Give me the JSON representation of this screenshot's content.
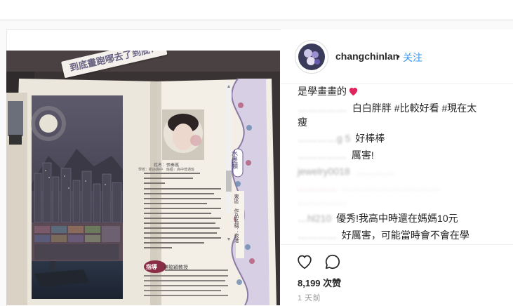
{
  "colors": {
    "accent": "#3897f0",
    "heart": "#ed4956",
    "text": "#262626",
    "muted": "#999999"
  },
  "header": {
    "username": "changchinlan",
    "separator": "•",
    "follow_label": "关注"
  },
  "photo": {
    "banner": "到底畫跑哪去了到底？",
    "side_label_1": "水墨類",
    "side_label_2": "東區　作品名稱：夜港",
    "caption_block_1": "姓名：張秦嵐",
    "caption_block_2": "學校：新店高中　班級：高中普通班",
    "teacher_label": "指導",
    "teacher_name": "林懿穎教授"
  },
  "comments": [
    {
      "user": "",
      "text": "是學畫畫的",
      "emoji": "heart-emoji"
    },
    {
      "user": "……………",
      "text": "白白胖胖 #比較好看 #現在太"
    },
    {
      "user": "",
      "text": "瘦"
    },
    {
      "user": "…………g 5",
      "text": "好棒棒"
    },
    {
      "user": "……………",
      "text": "厲害!"
    },
    {
      "user": "jewelry0018",
      "text": "…………"
    },
    {
      "user": "…………",
      "text": "…………………………"
    },
    {
      "user": "",
      "text": "……………"
    },
    {
      "user": "…hl210",
      "text": "優秀!我高中時還在媽媽10元"
    },
    {
      "user": "…………",
      "text": "好厲害，可能當時會不會在學"
    }
  ],
  "actions": {
    "like_icon": "heart-outline-icon",
    "comment_icon": "comment-bubble-icon"
  },
  "likes": {
    "count_label": "8,199 次赞"
  },
  "time": {
    "label": "1 天前"
  }
}
